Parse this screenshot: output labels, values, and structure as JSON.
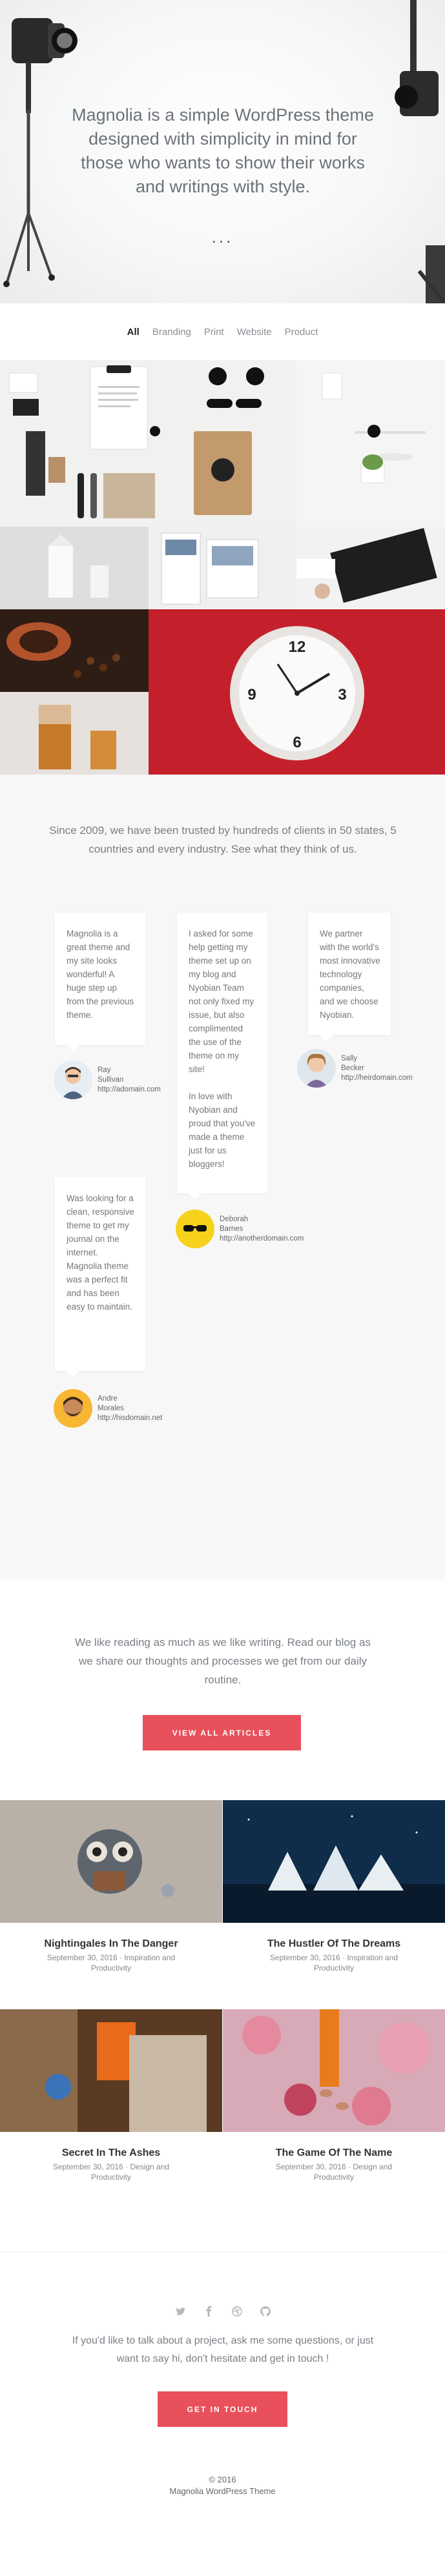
{
  "hero": {
    "text": "Magnolia is a simple WordPress theme designed with simplicity in mind for those who wants to show their works and writings with style.",
    "dots": "..."
  },
  "filter": {
    "items": [
      "All",
      "Branding",
      "Print",
      "Website",
      "Product"
    ],
    "active": "All"
  },
  "testimonials": {
    "intro": "Since 2009, we have been trusted by hundreds of clients in 50 states, 5 countries and every industry. See what they think of us.",
    "items": [
      {
        "quote": "Magnolia is a great theme and my site looks wonderful! A huge step up from the previous theme.",
        "name": "Ray Sullivan",
        "site": "http://adomain.com"
      },
      {
        "quote": "I asked for some help getting my theme set up on my blog and Nyobian Team not only fixed my issue, but also complimented the use of the theme on my site!",
        "quote2": "In love with Nyobian and proud that you've made a theme just for us bloggers!",
        "name": "Deborah Barnes",
        "site": "http://anotherdomain.com"
      },
      {
        "quote": "We partner with the world's most innovative technology companies, and we choose Nyobian.",
        "name": "Sally Becker",
        "site": "http://heirdomain.com"
      },
      {
        "quote": "Was looking for a clean, responsive theme to get my journal on the internet. Magnolia theme was a perfect fit and has been easy to maintain.",
        "name": "Andre Morales",
        "site": "http://hisdomain.net"
      }
    ]
  },
  "blog": {
    "intro": "We like reading as much as we like writing. Read our blog as we share our thoughts and processes we get from our daily routine.",
    "button": "VIEW ALL ARTICLES",
    "posts": [
      {
        "title": "Nightingales In The Danger",
        "meta": "September 30, 2016 · Inspiration and Productivity"
      },
      {
        "title": "The Hustler Of The Dreams",
        "meta": "September 30, 2016 · Inspiration and Productivity"
      },
      {
        "title": "Secret In The Ashes",
        "meta": "September 30, 2016 · Design and Productivity"
      },
      {
        "title": "The Game Of The Name",
        "meta": "September 30, 2016 · Design and Productivity"
      }
    ]
  },
  "contact": {
    "socials": [
      "twitter-icon",
      "facebook-icon",
      "dribbble-icon",
      "github-icon"
    ],
    "text": "If you'd like to talk about a project, ask me some questions, or just want to say hi, don't hesitate and get in touch !",
    "button": "GET IN TOUCH"
  },
  "footer": {
    "copyright": "© 2016",
    "credit": "Magnolia WordPress Theme"
  }
}
